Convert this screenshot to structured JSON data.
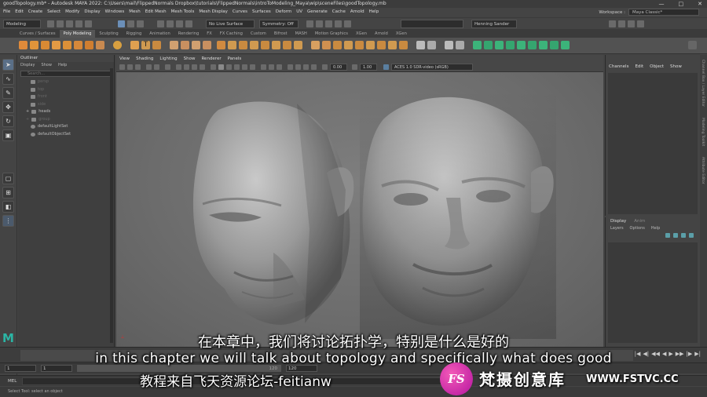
{
  "window": {
    "title": "goodTopology.mb* - Autodesk MAYA 2022: C:\\Users\\mail\\FlippedNormals Dropbox\\tutorials\\FlippedNormals\\introToModeling_Maya\\wip\\sceneFiles\\goodTopology.mb",
    "controls": [
      "—",
      "□",
      "✕"
    ]
  },
  "menubar": {
    "items": [
      "File",
      "Edit",
      "Create",
      "Select",
      "Modify",
      "Display",
      "Windows",
      "Mesh",
      "Edit Mesh",
      "Mesh Tools",
      "Mesh Display",
      "Curves",
      "Surfaces",
      "Deform",
      "UV",
      "Generate",
      "Cache",
      "Arnold",
      "Help"
    ],
    "workspace_label": "Workspace :",
    "workspace_value": "Maya Classic*"
  },
  "statusline": {
    "mode": "Modeling",
    "live_surface": "No Live Surface",
    "symmetry": "Symmetry: Off",
    "user": "Henning Sander"
  },
  "shelf_tabs": {
    "items": [
      "Curves / Surfaces",
      "Poly Modeling",
      "Sculpting",
      "Rigging",
      "Animation",
      "Rendering",
      "FX",
      "FX Caching",
      "Custom",
      "Bifrost",
      "MASH",
      "Motion Graphics",
      "XGen",
      "Arnold",
      "XGen"
    ],
    "active": "Poly Modeling"
  },
  "outliner": {
    "title": "Outliner",
    "menu": [
      "Display",
      "Show",
      "Help"
    ],
    "search_placeholder": "Search...",
    "items": [
      "persp",
      "top",
      "front",
      "side",
      "heads",
      "group",
      "defaultLightSet",
      "defaultObjectSet"
    ]
  },
  "viewport": {
    "menu": [
      "View",
      "Shading",
      "Lighting",
      "Show",
      "Renderer",
      "Panels"
    ],
    "exposure": "0.00",
    "gamma": "1.00",
    "color_space": "ACES 1.0 SDR-video (sRGB)"
  },
  "channel_box": {
    "menu": [
      "Channels",
      "Edit",
      "Object",
      "Show"
    ]
  },
  "layer_editor": {
    "tabs": [
      "Display",
      "Anim"
    ],
    "menu": [
      "Layers",
      "Options",
      "Help"
    ]
  },
  "side_tabs": [
    "Channel Box / Layer Editor",
    "Modeling Toolkit",
    "Attribute Editor"
  ],
  "timeline": {
    "range_start": "1",
    "range_inner_start": "1",
    "range_end_label": "120",
    "range_end": "120",
    "playback": [
      "|◀",
      "◀|",
      "◀◀",
      "◀",
      "▶",
      "▶▶",
      "|▶",
      "▶|"
    ]
  },
  "command_line": {
    "label": "MEL"
  },
  "help_line": "Select Tool: select an object",
  "subtitles": {
    "zh": "在本章中，我们将讨论拓扑学，特别是什么是好的",
    "en": "in this chapter we will talk about topology and specifically what does good",
    "watermark_forum": "教程来自飞天资源论坛-feitianw"
  },
  "watermark": {
    "logo_text": "FS",
    "brand_cn": "梵摄创意库",
    "url": "WWW.FSTVC.CC"
  },
  "colors": {
    "maya_logo": "#2bb5a5",
    "watermark_pink": "#d62ab0",
    "viewport_bg": "#6a6a6a"
  }
}
